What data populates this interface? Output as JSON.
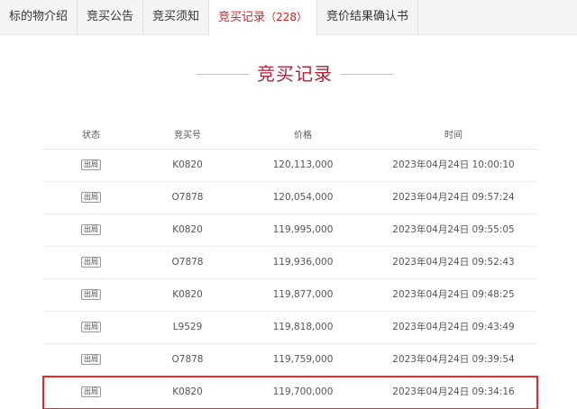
{
  "tabs": [
    {
      "label": "标的物介绍"
    },
    {
      "label": "竞买公告"
    },
    {
      "label": "竞买须知"
    },
    {
      "label": "竞买记录",
      "count": "（228）",
      "active": true
    },
    {
      "label": "竞价结果确认书"
    }
  ],
  "section": {
    "title": "竞买记录"
  },
  "table": {
    "headers": [
      "状态",
      "竞买号",
      "价格",
      "时间"
    ],
    "rows": [
      {
        "status": "出局",
        "bid_no": "K0820",
        "price": "120,113,000",
        "time": "2023年04月24日 10:00:10"
      },
      {
        "status": "出局",
        "bid_no": "O7878",
        "price": "120,054,000",
        "time": "2023年04月24日 09:57:24"
      },
      {
        "status": "出局",
        "bid_no": "K0820",
        "price": "119,995,000",
        "time": "2023年04月24日 09:55:05"
      },
      {
        "status": "出局",
        "bid_no": "O7878",
        "price": "119,936,000",
        "time": "2023年04月24日 09:52:43"
      },
      {
        "status": "出局",
        "bid_no": "K0820",
        "price": "119,877,000",
        "time": "2023年04月24日 09:48:25"
      },
      {
        "status": "出局",
        "bid_no": "L9529",
        "price": "119,818,000",
        "time": "2023年04月24日 09:43:49"
      },
      {
        "status": "出局",
        "bid_no": "O7878",
        "price": "119,759,000",
        "time": "2023年04月24日 09:39:54"
      },
      {
        "status": "出局",
        "bid_no": "K0820",
        "price": "119,700,000",
        "time": "2023年04月24日 09:34:16"
      }
    ]
  },
  "colors": {
    "accent": "#d51d1d",
    "title": "#b0213a",
    "highlight_border": "#e02b2b"
  }
}
